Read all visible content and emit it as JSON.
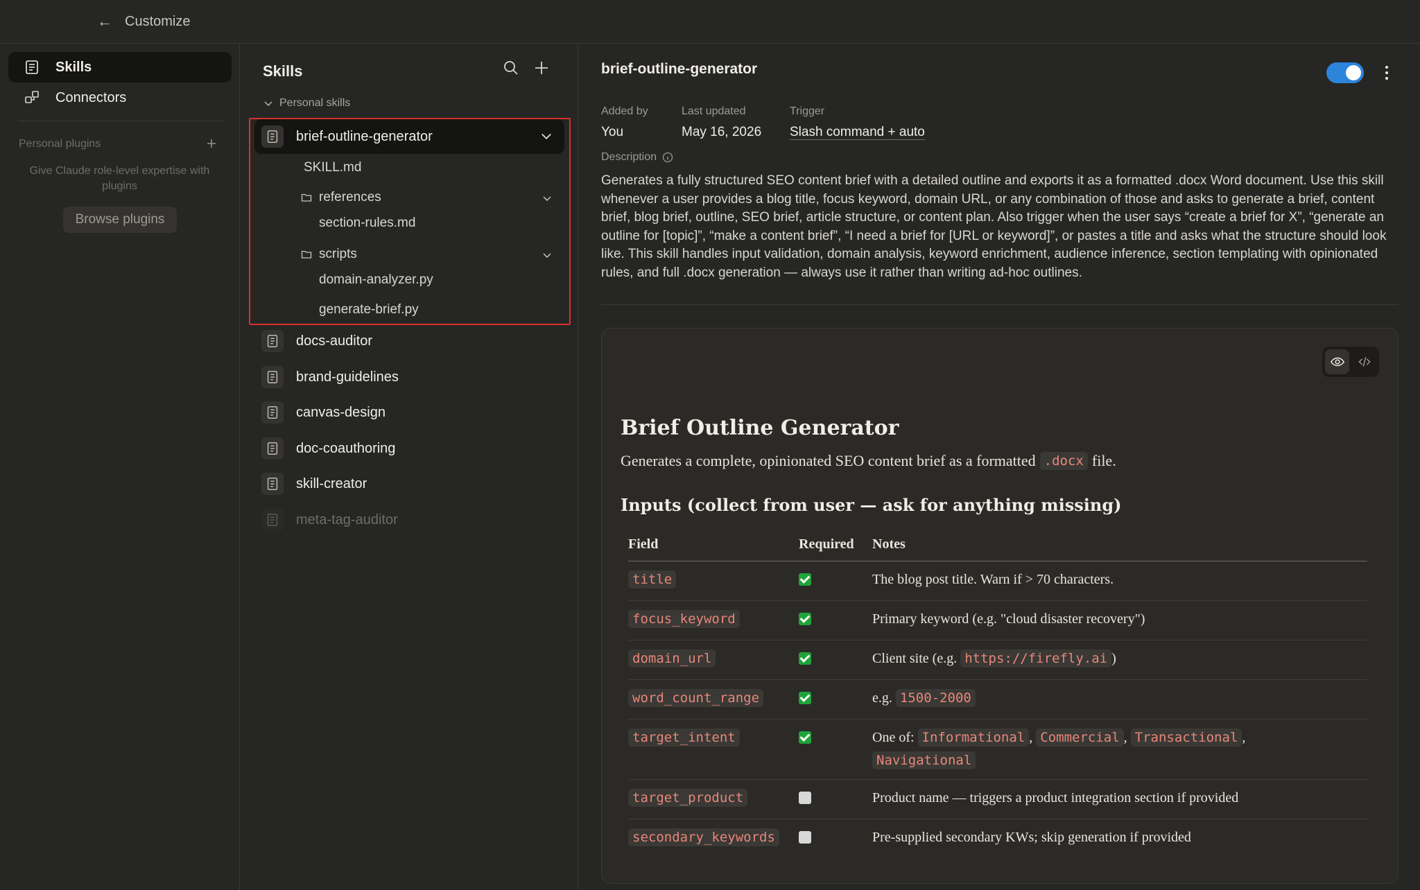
{
  "topbar": {
    "back_icon": "arrow-left-icon",
    "title": "Customize"
  },
  "leftnav": {
    "items": [
      {
        "label": "Skills",
        "icon": "skills-icon",
        "active": true
      },
      {
        "label": "Connectors",
        "icon": "connectors-icon",
        "active": false
      }
    ],
    "plugins_heading": "Personal plugins",
    "plugins_hint": "Give Claude role-level expertise with plugins",
    "browse_label": "Browse plugins"
  },
  "skills_panel": {
    "title": "Skills",
    "section_label": "Personal skills",
    "selected_skill": {
      "name": "brief-outline-generator",
      "files": {
        "skill_md": "SKILL.md",
        "references_folder": "references",
        "references_files": [
          "section-rules.md"
        ],
        "scripts_folder": "scripts",
        "scripts_files": [
          "domain-analyzer.py",
          "generate-brief.py"
        ]
      }
    },
    "other_skills": [
      "docs-auditor",
      "brand-guidelines",
      "canvas-design",
      "doc-coauthoring",
      "skill-creator",
      "meta-tag-auditor"
    ],
    "disabled_skill": "meta-tag-auditor"
  },
  "detail": {
    "title": "brief-outline-generator",
    "enabled": true,
    "meta": {
      "added_by_label": "Added by",
      "added_by": "You",
      "updated_label": "Last updated",
      "updated": "May 16, 2026",
      "trigger_label": "Trigger",
      "trigger": "Slash command + auto"
    },
    "description_label": "Description",
    "description": "Generates a fully structured SEO content brief with a detailed outline and exports it as a formatted .docx Word document. Use this skill whenever a user provides a blog title, focus keyword, domain URL, or any combination of those and asks to generate a brief, content brief, blog brief, outline, SEO brief, article structure, or content plan. Also trigger when the user says “create a brief for X”, “generate an outline for [topic]”, “make a content brief”, “I need a brief for [URL or keyword]”, or pastes a title and asks what the structure should look like. This skill handles input validation, domain analysis, keyword enrichment, audience inference, section templating with opinionated rules, and full .docx generation — always use it rather than writing ad-hoc outlines.",
    "doc": {
      "h1": "Brief Outline Generator",
      "intro_before": "Generates a complete, opinionated SEO content brief as a formatted",
      "intro_code": ".docx",
      "intro_after": "file.",
      "h2": "Inputs (collect from user — ask for anything missing)",
      "columns": [
        "Field",
        "Required",
        "Notes"
      ],
      "rows": [
        {
          "field": "title",
          "required": true,
          "notes": "The blog post title. Warn if > 70 characters."
        },
        {
          "field": "focus_keyword",
          "required": true,
          "notes": "Primary keyword (e.g. \"cloud disaster recovery\")"
        },
        {
          "field": "domain_url",
          "required": true,
          "notes_before": "Client site (e.g.",
          "notes_code": "https://firefly.ai",
          "notes_after": ")"
        },
        {
          "field": "word_count_range",
          "required": true,
          "notes_before": "e.g.",
          "notes_code": "1500-2000"
        },
        {
          "field": "target_intent",
          "required": true,
          "notes_before": "One of:",
          "intent_codes": [
            "Informational",
            "Commercial",
            "Transactional",
            "Navigational"
          ]
        },
        {
          "field": "target_product",
          "required": false,
          "notes": "Product name — triggers a product integration section if provided"
        },
        {
          "field": "secondary_keywords",
          "required": false,
          "notes": "Pre-supplied secondary KWs; skip generation if provided"
        }
      ]
    }
  }
}
